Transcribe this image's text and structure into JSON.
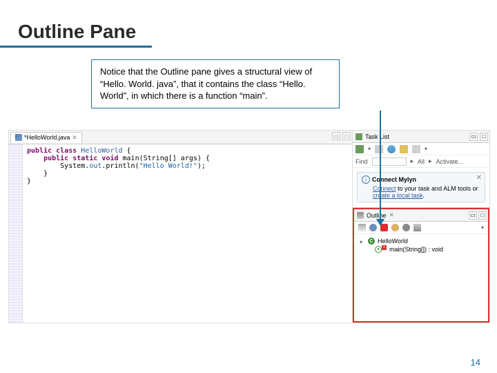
{
  "slide": {
    "title": "Outline Pane",
    "note": "Notice that the Outline pane gives a structural view of “Hello. World. java”, that it contains the class “Hello. World”, in which there is a function “main”.",
    "page_number": "14"
  },
  "editor": {
    "tab_label": "*HelloWorld.java",
    "code": {
      "line1_kw1": "public",
      "line1_kw2": "class",
      "line1_cls": "HelloWorld",
      "line1_brace": " {",
      "line2_indent": "    ",
      "line2_kw1": "public",
      "line2_kw2": "static",
      "line2_kw3": "void",
      "line2_name": " main(String[] args) {",
      "line3_indent": "        System.",
      "line3_out": "out",
      "line3_rest": ".println(",
      "line3_str": "\"Hello World!\"",
      "line3_close": ");",
      "line4": "    }",
      "line5": "}"
    }
  },
  "tasklist": {
    "tab_label": "Task List",
    "find_label": "Find",
    "find_placeholder": "",
    "all_label": "All",
    "activate_label": "Activate...",
    "mylyn_title": "Connect Mylyn",
    "mylyn_link1": "Connect",
    "mylyn_text1": " to your task and ALM tools or ",
    "mylyn_link2": "create a local task",
    "mylyn_text2": "."
  },
  "outline": {
    "tab_label": "Outline",
    "class_label": "HelloWorld",
    "method_label": "main(String[]) : void"
  }
}
